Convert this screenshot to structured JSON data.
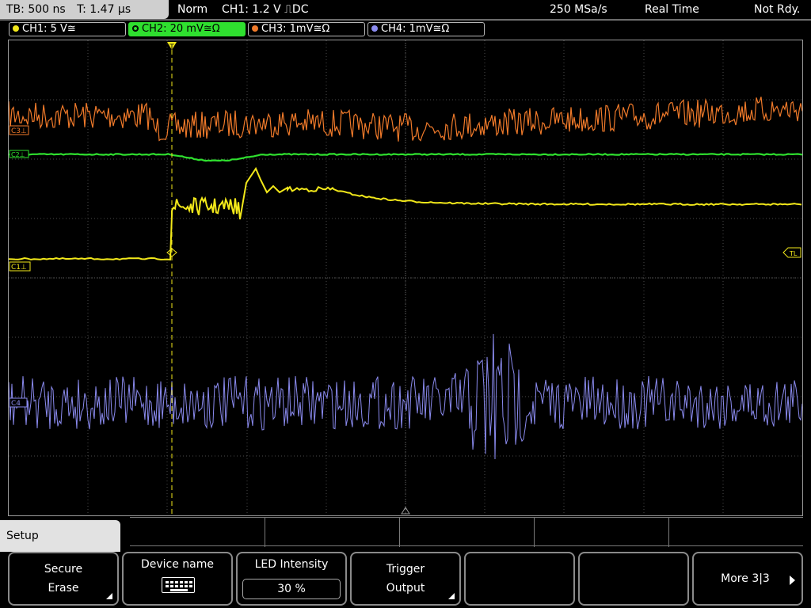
{
  "topbar": {
    "timebase": "TB: 500 ns",
    "trigger_time": "T: 1.47 µs",
    "trigger_mode": "Norm",
    "trigger_info": "CH1: 1.2 V ⎍DC",
    "sample_rate": "250 MSa/s",
    "acq_mode": "Real Time",
    "status": "Not Rdy."
  },
  "channels": [
    {
      "label": "CH1: 5 V≅",
      "color": "#f2e81a"
    },
    {
      "label": "CH2: 20 mV≅Ω",
      "color": "#2fe02f",
      "active": true
    },
    {
      "label": "CH3: 1mV≅Ω",
      "color": "#f07a2a"
    },
    {
      "label": "CH4: 1mV≅Ω",
      "color": "#8a8aee"
    }
  ],
  "markers": {
    "c3": "C3⊥",
    "c2": "C2⊥",
    "c1": "C1⊥",
    "c4": "C4",
    "trigger_level": "TL",
    "trigger_pos": "T"
  },
  "colors": {
    "ch1": "#f2e81a",
    "ch2": "#2fe02f",
    "ch3": "#f07a2a",
    "ch4": "#8a8aee",
    "grid": "#4a4a4a"
  },
  "menu": {
    "title": "Setup",
    "softkeys": [
      {
        "line1": "Secure",
        "line2": "Erase"
      },
      {
        "line1": "Device name",
        "icon": "keyboard-icon"
      },
      {
        "line1": "LED Intensity",
        "value": "30 %"
      },
      {
        "line1": "Trigger",
        "line2": "Output"
      },
      {
        "line1": ""
      },
      {
        "line1": ""
      },
      {
        "line1": "More 3|3"
      }
    ]
  }
}
